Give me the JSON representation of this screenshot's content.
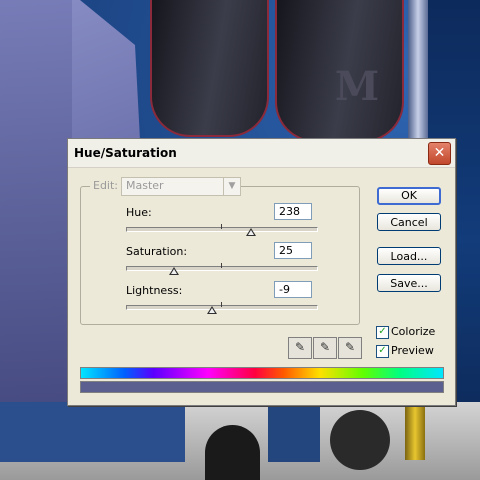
{
  "dialog": {
    "title": "Hue/Saturation",
    "close_symbol": "✕",
    "edit_label": "Edit:",
    "edit_value": "Master",
    "hue": {
      "label": "Hue:",
      "value": "238",
      "level": 0.66
    },
    "saturation": {
      "label": "Saturation:",
      "value": "25",
      "level": 0.25
    },
    "lightness": {
      "label": "Lightness:",
      "value": "-9",
      "level": 0.455
    },
    "buttons": {
      "ok": "OK",
      "cancel": "Cancel",
      "load": "Load...",
      "save": "Save..."
    },
    "colorize": {
      "label": "Colorize",
      "checked": true
    },
    "preview": {
      "label": "Preview",
      "checked": true
    },
    "checkmark": "✓",
    "eyedroppers": [
      "eyedropper-icon",
      "eyedropper-plus-icon",
      "eyedropper-minus-icon"
    ],
    "colorized_hue": "#5a5f8f"
  },
  "background": {
    "logo_text": "M"
  }
}
